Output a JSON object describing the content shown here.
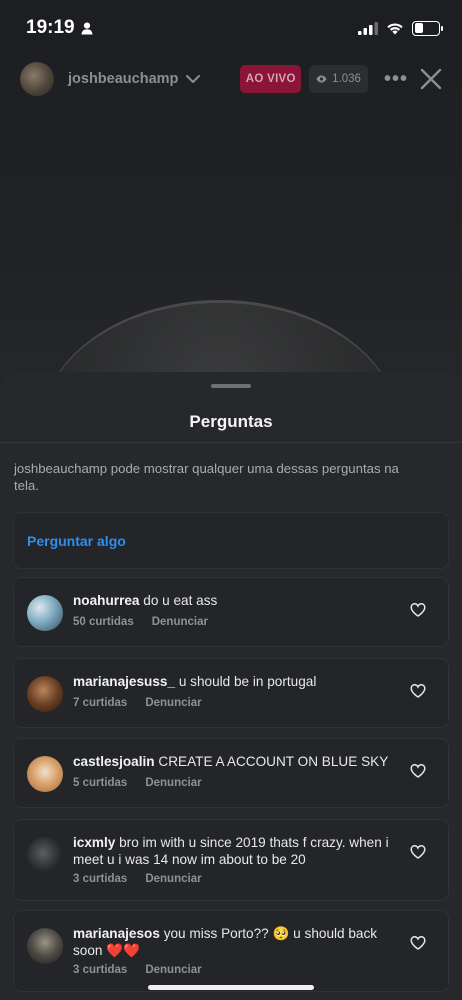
{
  "status_bar": {
    "time": "19:19"
  },
  "header": {
    "host_username": "joshbeauchamp",
    "live_label": "AO VIVO",
    "viewer_count": "1.036"
  },
  "sheet": {
    "title": "Perguntas",
    "description": "joshbeauchamp pode mostrar qualquer uma dessas perguntas na tela.",
    "ask_label": "Perguntar algo"
  },
  "questions": [
    {
      "username": "noahurrea",
      "text": "do u eat ass",
      "likes": "50 curtidas",
      "report": "Denunciar"
    },
    {
      "username": "marianajesuss_",
      "text": "u should be in portugal",
      "likes": "7 curtidas",
      "report": "Denunciar"
    },
    {
      "username": "castlesjoalin",
      "text": "CREATE A ACCOUNT ON BLUE SKY",
      "likes": "5 curtidas",
      "report": "Denunciar"
    },
    {
      "username": "icxmly",
      "text": "bro im with u since 2019 thats f crazy. when i meet u i was 14 now im about to be 20",
      "likes": "3 curtidas",
      "report": "Denunciar"
    },
    {
      "username": "marianajesos",
      "text": "you miss Porto?? 🥺 u should back soon ❤️❤️",
      "likes": "3 curtidas",
      "report": "Denunciar"
    }
  ],
  "icons": {
    "person": "person-icon",
    "signal": "signal-icon",
    "wifi": "wifi-icon",
    "battery": "battery-icon",
    "chevron": "chevron-down-icon",
    "eye": "eye-icon",
    "more": "more-icon",
    "close": "close-icon",
    "heart": "heart-icon"
  },
  "colors": {
    "live_badge": "#8a1538",
    "link_blue": "#2f8ef1",
    "sheet_bg": "#26282c"
  }
}
